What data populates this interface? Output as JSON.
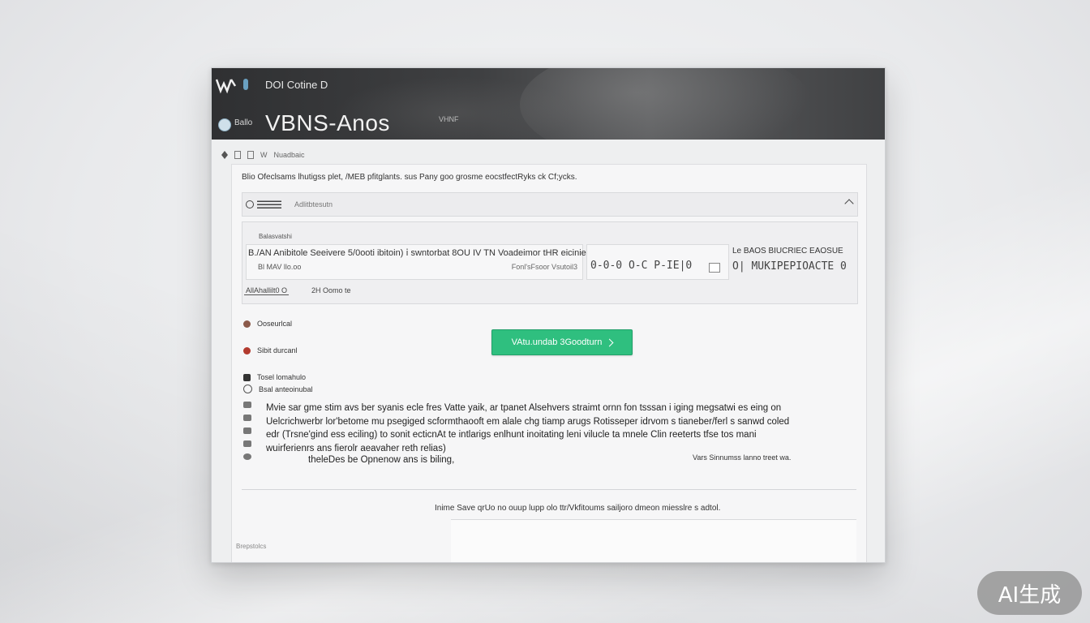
{
  "header": {
    "top_title": "DOI Cotine D",
    "badge_text": "Ballo",
    "title": "VBNS-Anos",
    "caption": "VHNF"
  },
  "breadcrumb": {
    "items": [
      "W",
      "Nuadbaic"
    ]
  },
  "intro": "Blio  Ofeclsams lhutigss plet, /MEB pfitglants. sus Pany goo grosme eocstfectRyks ck Cf;ycks.",
  "search": {
    "placeholder": "Adlitbtesutn"
  },
  "options": {
    "label": "Balasvatshi",
    "row_a_title": "B./AN Anibitole Seeivere 5/0ooti ibitoin) ⅰ swntorbat 8OU IV  TN Voadeimor tHR  eicinie  MUPE",
    "row_a_sub": "Bl MAV  llo.oo",
    "row_a_right": "Fonl'sFsoor Vsutoil3",
    "row_b_value": "0-0-0 O-C P-IE|0",
    "row_c_title": "Le  BAOS BIUCRIEC EAOSUE",
    "row_c_value": "O|  MUKIPEPIOACTE 0",
    "foot_left": "AllAhallilt0  O",
    "foot_right": "2H  Oomo te"
  },
  "side_items": [
    {
      "label": "Ooseurlcal",
      "color": "#8b5a4a"
    },
    {
      "label": "Sibit durcanl",
      "color": "#b23a2e"
    },
    {
      "label": "Tosel lomahulo",
      "color": "#333333"
    },
    {
      "label": "Bsal anteoinubal",
      "color": "#333333"
    }
  ],
  "cta": {
    "label": "VAtu.undab 3Goodturn"
  },
  "body": {
    "lines": [
      "Mvie sar gme stim avs ber syanis ecle fres Vatte yaik, ar tpanet Alsehvers straimt ornn fon tsssan i iging megsatwi es eing on",
      "Uelcrichwerbr lor'betome mu psegiged scformthaooft em alale chg tiamp arugs Rotisseper idrvom s tianeber/ferl s sanwd coled",
      "edr (Trsne'gind ess eciling) to sonit ecticnAt te intlarigs enlhunt inoitating leni vilucle ta mnele Clin reeterts tfse tos mani",
      "wuirferienrs ans fierolr aeavaher reth relias)"
    ],
    "last_line": "theleDes be Opnenow ans is biling,",
    "right_note": "Vars Sinnumss lanno treet wa."
  },
  "footer": {
    "note": "Inime Save  qrUo no  ouup  lupp olo  ttr/Vkfitoums  sailjoro dmeon  miesslre  s adtol.",
    "window_foot": "Brepstolcs"
  },
  "watermark": "AI生成",
  "colors": {
    "accent": "#2fbf7f",
    "header_bg": "#3a3b3d"
  }
}
